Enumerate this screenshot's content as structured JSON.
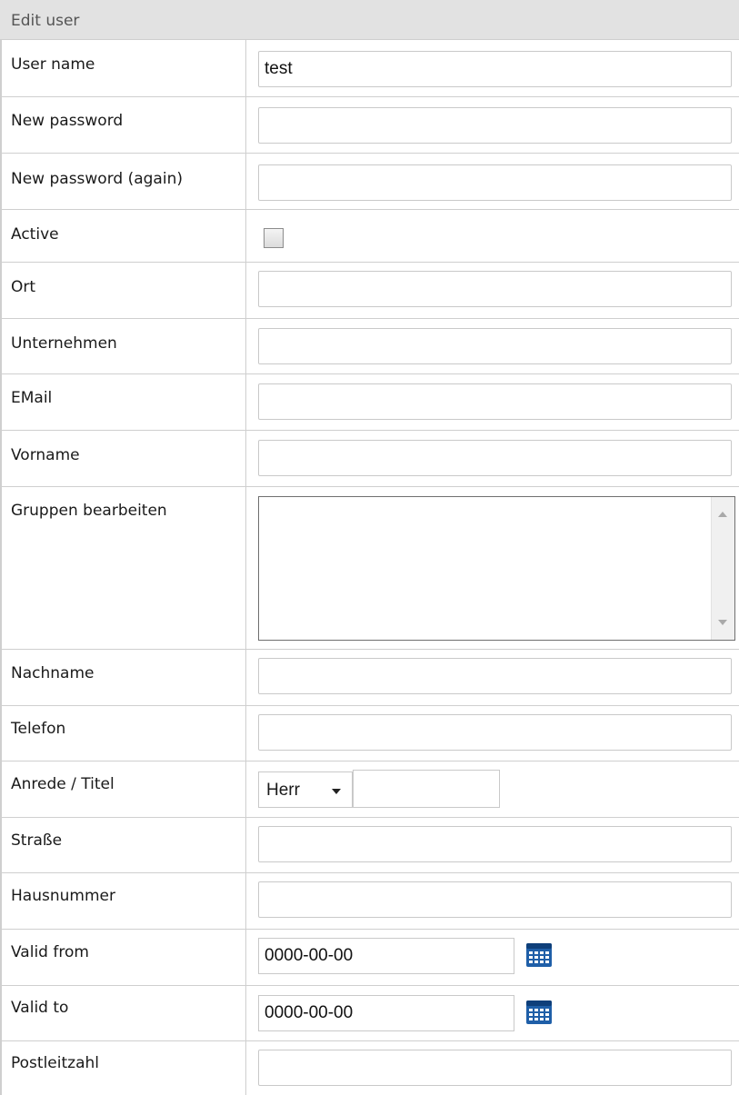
{
  "form": {
    "title": "Edit user",
    "fields": {
      "username": {
        "label": "User name",
        "value": "test"
      },
      "new_password": {
        "label": "New password",
        "value": ""
      },
      "new_password_again": {
        "label": "New password (again)",
        "value": ""
      },
      "active": {
        "label": "Active",
        "checked": false
      },
      "ort": {
        "label": "Ort",
        "value": ""
      },
      "unternehmen": {
        "label": "Unternehmen",
        "value": ""
      },
      "email": {
        "label": "EMail",
        "value": ""
      },
      "vorname": {
        "label": "Vorname",
        "value": ""
      },
      "gruppen": {
        "label": "Gruppen bearbeiten",
        "options": []
      },
      "nachname": {
        "label": "Nachname",
        "value": ""
      },
      "telefon": {
        "label": "Telefon",
        "value": ""
      },
      "anrede_titel": {
        "label": "Anrede / Titel",
        "selected": "Herr",
        "title_value": ""
      },
      "strasse": {
        "label": "Straße",
        "value": ""
      },
      "hausnummer": {
        "label": "Hausnummer",
        "value": ""
      },
      "valid_from": {
        "label": "Valid from",
        "value": "0000-00-00"
      },
      "valid_to": {
        "label": "Valid to",
        "value": "0000-00-00"
      },
      "postleitzahl": {
        "label": "Postleitzahl",
        "value": ""
      }
    }
  },
  "icons": {
    "calendar": "calendar-icon",
    "caret": "chevron-down-icon"
  },
  "colors": {
    "header_bg": "#e2e2e2",
    "border": "#cfcfcf",
    "calendar_blue": "#1f5fa8"
  }
}
